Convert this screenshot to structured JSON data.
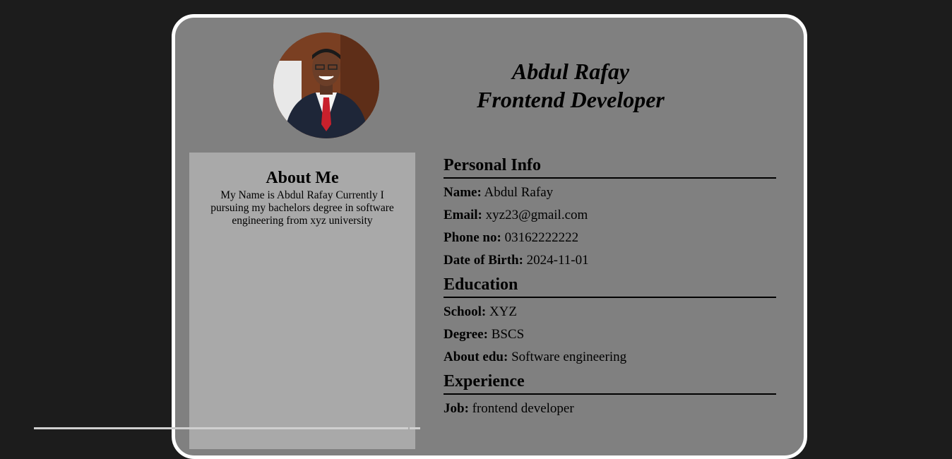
{
  "header": {
    "name": "Abdul Rafay",
    "role": "Frontend Developer",
    "photo_icon": "profile-photo"
  },
  "about": {
    "title": "About Me",
    "text": "My Name is Abdul Rafay Currently I pursuing my bachelors degree in software engineering from xyz university"
  },
  "personal": {
    "title": "Personal Info",
    "name_label": "Name:",
    "name_value": " Abdul Rafay",
    "email_label": "Email:",
    "email_value": " xyz23@gmail.com",
    "phone_label": "Phone no:",
    "phone_value": " 03162222222",
    "dob_label": "Date of Birth:",
    "dob_value": " 2024-11-01"
  },
  "education": {
    "title": "Education",
    "school_label": "School:",
    "school_value": " XYZ",
    "degree_label": "Degree:",
    "degree_value": " BSCS",
    "about_label": "About edu:",
    "about_value": " Software engineering"
  },
  "experience": {
    "title": "Experience",
    "job_label": "Job:",
    "job_value": " frontend developer"
  },
  "colors": {
    "page_bg": "#1c1c1c",
    "card_bg": "#808080",
    "card_border": "#ffffff",
    "sidebar_bg": "#a9a9a9"
  }
}
